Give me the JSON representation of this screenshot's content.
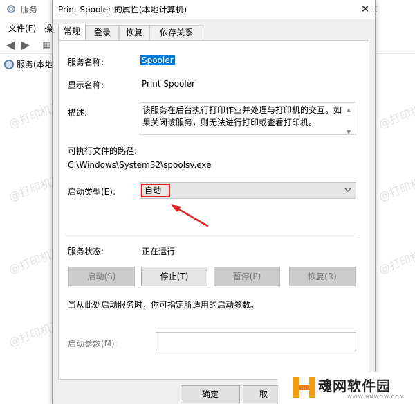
{
  "background": {
    "title": "服务",
    "menu": [
      "文件(F)",
      "操"
    ],
    "tree_item": "服务(本地"
  },
  "dialog": {
    "title": "Print Spooler 的属性(本地计算机)",
    "tabs": [
      "常规",
      "登录",
      "恢复",
      "依存关系"
    ],
    "service_name_label": "服务名称:",
    "service_name_value": "Spooler",
    "display_name_label": "显示名称:",
    "display_name_value": "Print Spooler",
    "description_label": "描述:",
    "description_value": "该服务在后台执行打印作业并处理与打印机的交互。如果关闭该服务，则无法进行打印或查看打印机。",
    "path_label": "可执行文件的路径:",
    "path_value": "C:\\Windows\\System32\\spoolsv.exe",
    "startup_type_label": "启动类型(E):",
    "startup_type_value": "自动",
    "status_label": "服务状态:",
    "status_value": "正在运行",
    "buttons": {
      "start": "启动(S)",
      "stop": "停止(T)",
      "pause": "暂停(P)",
      "resume": "恢复(R)"
    },
    "hint": "当从此处启动服务时，你可指定所适用的启动参数。",
    "start_params_label": "启动参数(M):",
    "ok": "确定",
    "next_button_partial": "取"
  },
  "watermark": "@打印机卫士",
  "logo": {
    "text": "魂网软件园",
    "sub": "WWW.HNWDW.COM"
  },
  "colors": {
    "accent_selection": "#0078d7",
    "highlight_box": "#e0201f",
    "arrow": "#e0201f"
  }
}
